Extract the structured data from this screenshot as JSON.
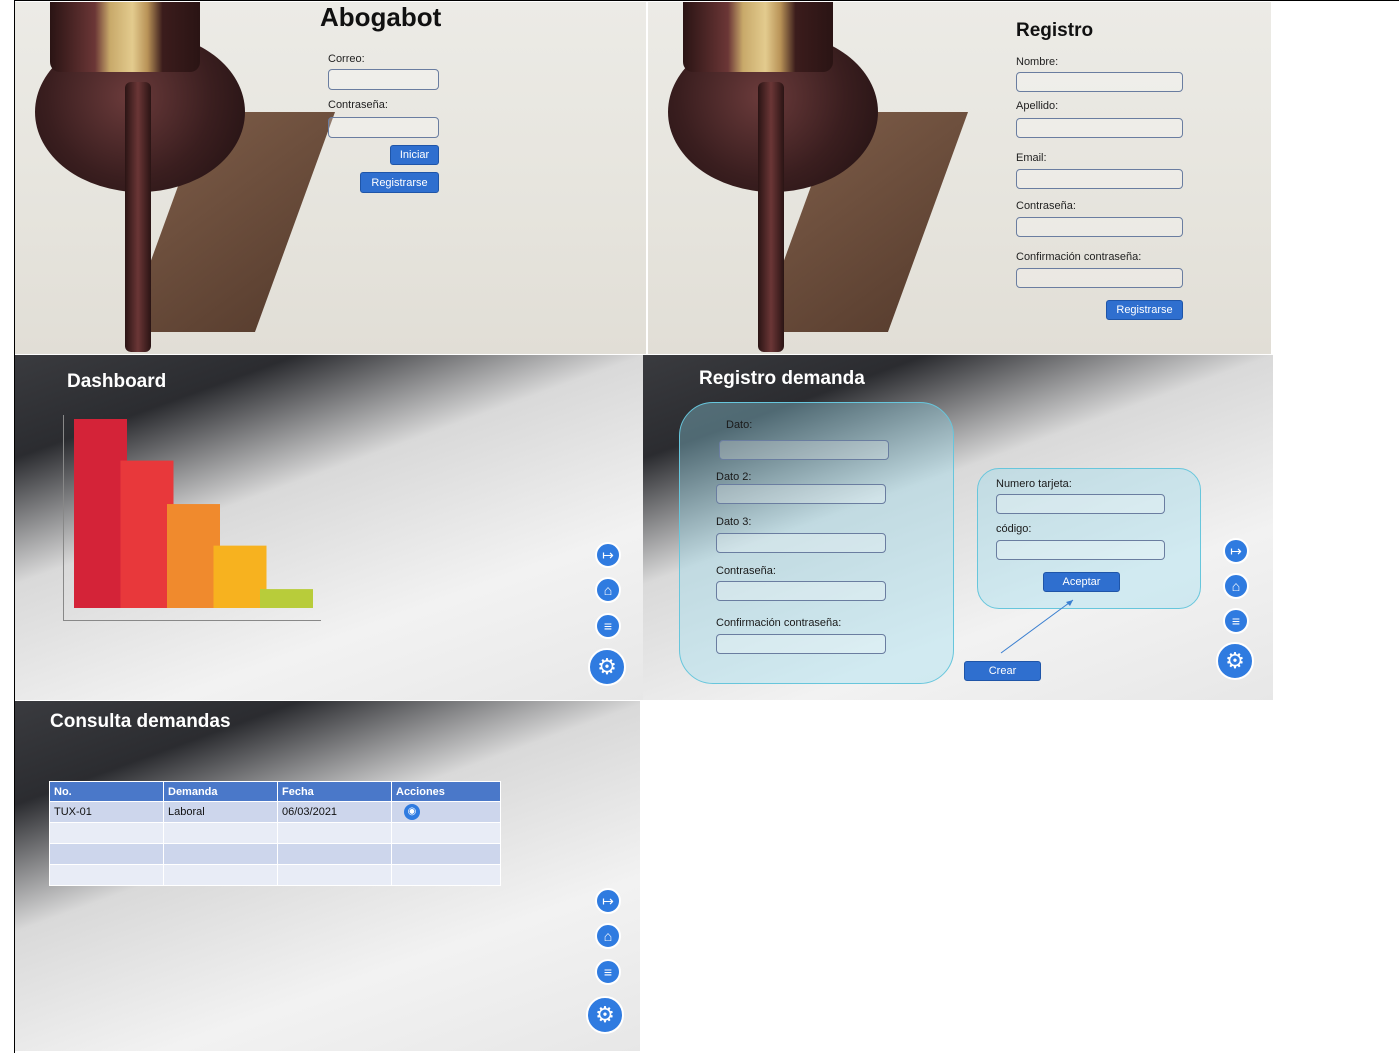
{
  "login": {
    "title": "Abogabot",
    "email_label": "Correo:",
    "password_label": "Contraseña:",
    "login_button": "Iniciar",
    "register_button": "Registrarse"
  },
  "registro": {
    "title": "Registro",
    "fields": [
      "Nombre:",
      "Apellido:",
      "Email:",
      "Contraseña:",
      "Confirmación contraseña:"
    ],
    "register_button": "Registrarse"
  },
  "dashboard": {
    "title": "Dashboard",
    "chart_colors": [
      "#d42338",
      "#e8383b",
      "#f08a2d",
      "#f7b21f",
      "#b8cc3a"
    ]
  },
  "chart_data": {
    "type": "bar",
    "categories": [
      "",
      "",
      "",
      "",
      ""
    ],
    "values": [
      100,
      78,
      55,
      33,
      10
    ]
  },
  "registro_demanda": {
    "title": "Registro demanda",
    "fields": [
      "Dato:",
      "Dato 2:",
      "Dato 3:",
      "Contraseña:",
      "Confirmación contraseña:"
    ],
    "card_fields": [
      "Numero tarjeta:",
      "código:"
    ],
    "accept_button": "Aceptar",
    "create_button": "Crear"
  },
  "consulta": {
    "title": "Consulta demandas",
    "columns": [
      "No.",
      "Demanda",
      "Fecha",
      "Acciones"
    ],
    "rows": [
      [
        "TUX-01",
        "Laboral",
        "06/03/2021"
      ],
      [
        "",
        "",
        ""
      ],
      [
        "",
        "",
        ""
      ],
      [
        "",
        "",
        ""
      ]
    ]
  },
  "side_icons": [
    "logout-icon",
    "home-icon",
    "list-icon",
    "gear-icon"
  ]
}
